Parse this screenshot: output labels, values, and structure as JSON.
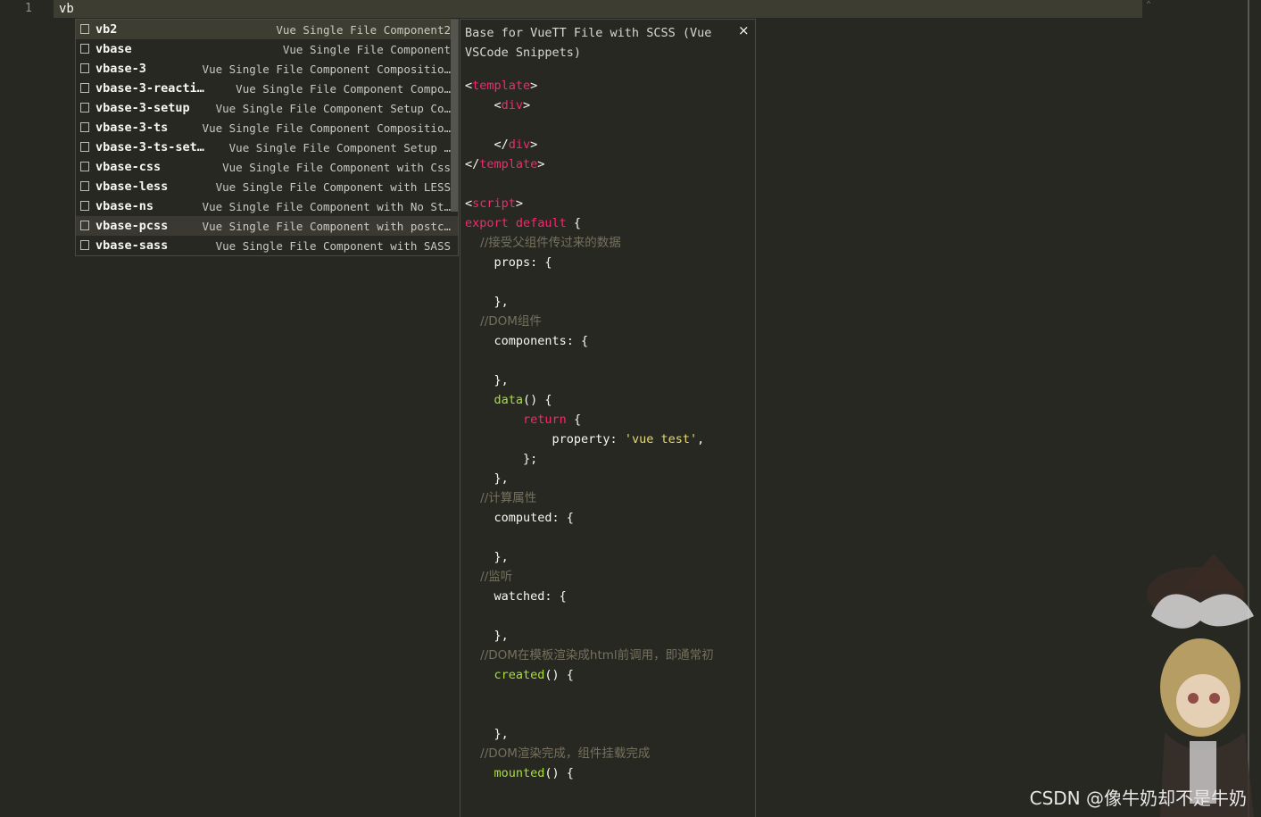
{
  "editor": {
    "line_number": "1",
    "typed_text": "vb"
  },
  "suggestions": [
    {
      "label": "vb2",
      "description": "Vue Single File Component2"
    },
    {
      "label": "vbase",
      "description": "Vue Single File Component"
    },
    {
      "label": "vbase-3",
      "description": "Vue Single File Component Compositio…"
    },
    {
      "label": "vbase-3-reacti…",
      "description": "Vue Single File Component Compo…"
    },
    {
      "label": "vbase-3-setup",
      "description": "Vue Single File Component Setup Co…"
    },
    {
      "label": "vbase-3-ts",
      "description": "Vue Single File Component Compositio…"
    },
    {
      "label": "vbase-3-ts-set…",
      "description": "Vue Single File Component Setup …"
    },
    {
      "label": "vbase-css",
      "description": "Vue Single File Component with Css"
    },
    {
      "label": "vbase-less",
      "description": "Vue Single File Component with LESS"
    },
    {
      "label": "vbase-ns",
      "description": "Vue Single File Component with No St…"
    },
    {
      "label": "vbase-pcss",
      "description": "Vue Single File Component with postc…"
    },
    {
      "label": "vbase-sass",
      "description": "Vue Single File Component with SASS"
    }
  ],
  "detail": {
    "title": "Base for VueTT File with SCSS (Vue VSCode Snippets)",
    "close_symbol": "×",
    "code": {
      "l1_open": "<",
      "l1_tag": "template",
      "l1_close": ">",
      "l2_open": "    <",
      "l2_tag": "div",
      "l2_close": ">",
      "l4_open": "    </",
      "l4_tag": "div",
      "l4_close": ">",
      "l5_open": "</",
      "l5_tag": "template",
      "l5_close": ">",
      "l7_open": "<",
      "l7_tag": "script",
      "l7_close": ">",
      "l8_kw": "export default",
      "l8_rest": " {",
      "l9_cmt": "    //接受父组件传过来的数据",
      "l10": "    props: {",
      "l12": "    },",
      "l13_cmt": "    //DOM组件",
      "l14": "    components: {",
      "l16": "    },",
      "l17_indent": "    ",
      "l17_fn": "data",
      "l17_rest": "() {",
      "l18_indent": "        ",
      "l18_kw": "return",
      "l18_rest": " {",
      "l19_key": "            property: ",
      "l19_str": "'vue test'",
      "l19_end": ",",
      "l20": "        };",
      "l21": "    },",
      "l22_cmt": "    //计算属性",
      "l23": "    computed: {",
      "l25": "    },",
      "l26_cmt": "    //监听",
      "l27": "    watched: {",
      "l29": "    },",
      "l30_cmt": "    //DOM在模板渲染成html前调用，即通常初",
      "l31_indent": "    ",
      "l31_fn": "created",
      "l31_rest": "() {",
      "l34": "    },",
      "l35_cmt": "    //DOM渲染完成，组件挂载完成",
      "l36_indent": "    ",
      "l36_fn": "mounted",
      "l36_rest": "() {"
    }
  },
  "watermark": "CSDN @像牛奶却不是牛奶",
  "icons": {
    "suggestion_icon": "snippet-icon",
    "close": "close-icon",
    "mascot": "mascot-icon"
  }
}
